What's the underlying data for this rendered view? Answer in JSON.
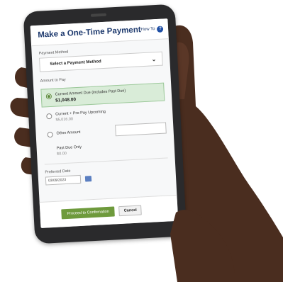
{
  "header": {
    "title": "Make a One-Time Payment",
    "how_to": "How To",
    "help_glyph": "?"
  },
  "payment_method": {
    "label": "Payment Method",
    "value": "Select a Payment Method"
  },
  "amount": {
    "label": "Amount to Pay",
    "options": [
      {
        "label": "Current Amount Due (includes Past Due)",
        "amount": "$1,048.00",
        "selected": true
      },
      {
        "label": "Current + Pre-Pay Upcoming",
        "amount": "$5,016.00",
        "selected": false
      },
      {
        "label": "Other Amount",
        "amount": "",
        "selected": false
      }
    ],
    "past_due": {
      "label": "Past Due Only",
      "amount": "$0.00"
    }
  },
  "date": {
    "label": "Preferred Date",
    "value": "03/09/2023"
  },
  "buttons": {
    "proceed": "Proceed to Confirmation",
    "cancel": "Cancel"
  },
  "colors": {
    "accent": "#6e9a3c",
    "title": "#1e3a6e",
    "selected_bg": "#d9ecd8"
  }
}
